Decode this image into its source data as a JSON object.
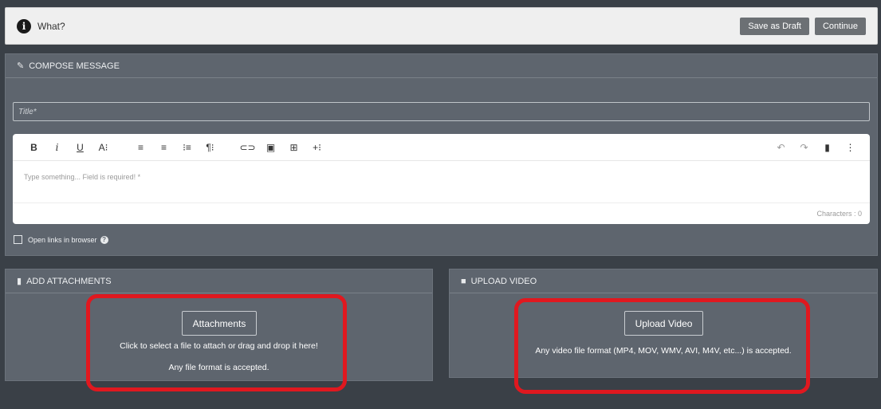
{
  "topbar": {
    "title": "What?",
    "save_draft_label": "Save as Draft",
    "continue_label": "Continue"
  },
  "compose": {
    "header": "COMPOSE MESSAGE",
    "title_placeholder": "Title*",
    "toolbar": {
      "bold": "B",
      "italic": "i",
      "underline": "U",
      "font_size": "A⁝",
      "align_left": "≡",
      "align_center": "≡",
      "ordered_list": "⁝≡",
      "paragraph": "¶⁝",
      "link": "⊂⊃",
      "image": "▣",
      "table": "⊞",
      "insert_more": "+⁝",
      "undo": "↶",
      "redo": "↷",
      "book": "▮",
      "more": "⋮"
    },
    "editor_placeholder": "Type something... Field is required! *",
    "char_count": "Characters : 0",
    "open_links_label": "Open links in browser",
    "help_icon": "?"
  },
  "attachments": {
    "header": "ADD ATTACHMENTS",
    "button_label": "Attachments",
    "line1": "Click to select a file to attach or drag and drop it here!",
    "line2": "Any file format is accepted."
  },
  "video": {
    "header": "UPLOAD VIDEO",
    "button_label": "Upload Video",
    "line1": "Any video file format (MP4, MOV, WMV, AVI, M4V, etc...) is accepted."
  },
  "colors": {
    "background": "#3a4047",
    "panel": "#5e656e",
    "highlight": "#e0181f"
  }
}
